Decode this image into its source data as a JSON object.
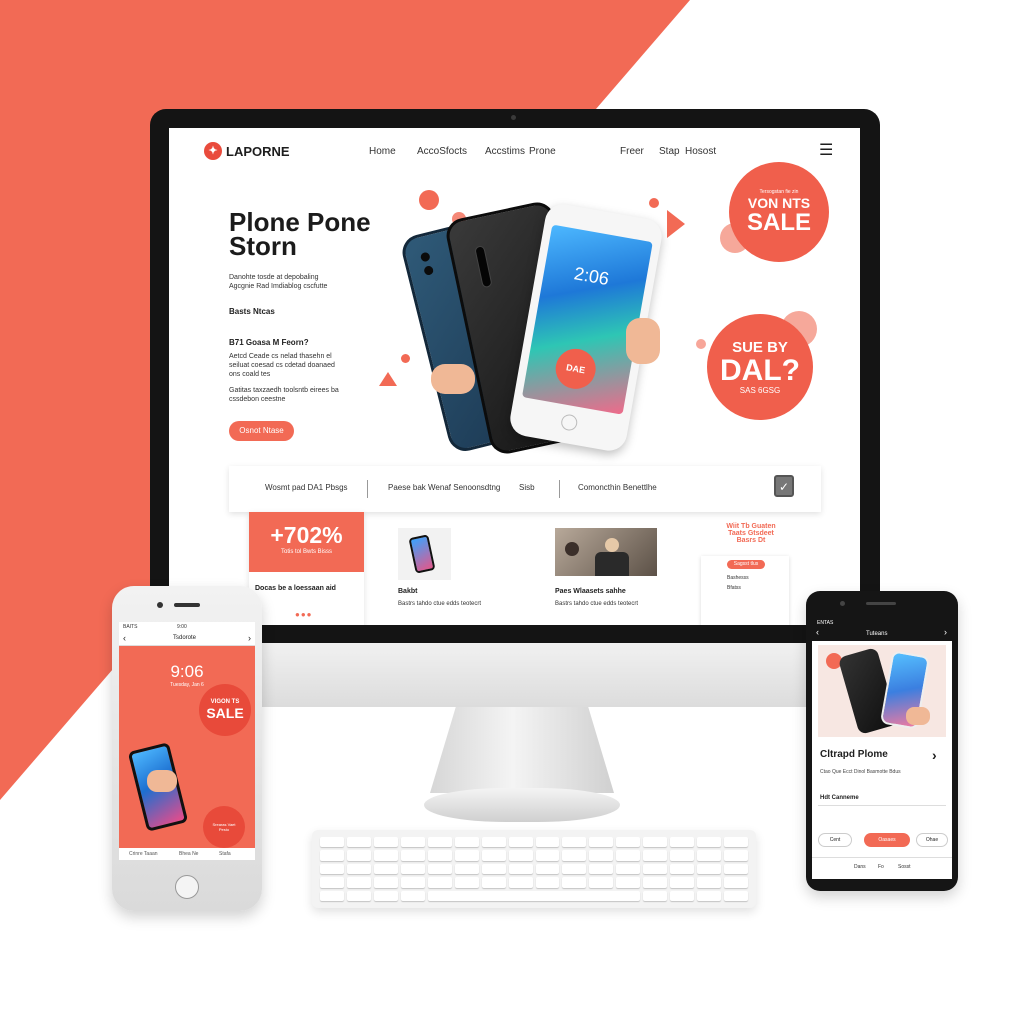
{
  "colors": {
    "accent": "#f26a55",
    "accent_dark": "#e94b3c",
    "frame": "#141414"
  },
  "desktop": {
    "brand": "LAPORNE",
    "nav": [
      "Home",
      "AccoSfocts",
      "Accstims",
      "Prone",
      "Freer",
      "Stap",
      "Hosost"
    ],
    "menu_icon": "hamburger-icon",
    "hero_title": "Plone Pone Storn",
    "hero_desc": "Danohte tosde at depobaling Agcgnie Rad Imdiablog cscfutte",
    "feature_label": "Basts Ntcas",
    "question": "B71 Goasa M Feorn?",
    "para1": "Aetcd Ceade cs nelad thasehn el seiluat coesad cs cdetad doanaed ons coald tes",
    "para2": "Gatitas taxzaedh toolsntb eirees ba cssdebon ceestne",
    "cta": "Osnot Ntase",
    "sale_badge_1": {
      "small": "Tersogstan fie zin",
      "big_top": "VON NTS",
      "big": "SALE"
    },
    "sale_badge_2": {
      "top": "SUE BY",
      "big": "DAL?",
      "small": "SAS 6GSG"
    },
    "phone_badge": "DAE",
    "phone_time": "2:06",
    "strip": [
      "Wosmt pad DA1 Pbsgs",
      "Paese bak Wenaf Senoonsdtng",
      "Sisb",
      "Comoncthin Benettlhe"
    ],
    "promo": {
      "percent": "+702%",
      "sub": "Totis tol Bwts Bisss",
      "label": "Docas be a loessaan aid"
    },
    "product1": {
      "title": "Bakbt",
      "desc": "Bastrs tahdo ctue edds teotecrt"
    },
    "product2": {
      "title": "Paes Wlaasets sahhe",
      "desc": "Bastrs tahdo ctue edds teotecrt"
    },
    "side_promo": "Wiit Tb Guaten Taats Gtsdeet Basrs Dt",
    "side_form": [
      "Sagsst tlus",
      "Bashesss",
      "Bfatss"
    ]
  },
  "iphone": {
    "carrier": "BAITS",
    "time_bar": "9:00",
    "nav_title": "Tsdorote",
    "lock_time": "9:06",
    "lock_date": "Tuesday, Jan 6",
    "sale_small": "VIGON TS",
    "sale_big": "SALE",
    "bottom_badge": "Srearas Vaet Pesto",
    "tabs": [
      "Crinre Taaan",
      "Bhea Ne",
      "Stafa"
    ]
  },
  "android": {
    "carrier": "ENTAS",
    "nav_title": "Tuteans",
    "product_title": "Cltrapd Plome",
    "desc": "Ctao Que Ecct Dinol Basmotte Bdus",
    "label": "Hdt Canneme",
    "buttons": [
      "Cent",
      "Oasaes",
      "Ohae"
    ],
    "tabs": [
      "Dans",
      "Fo",
      "Sosst"
    ]
  }
}
